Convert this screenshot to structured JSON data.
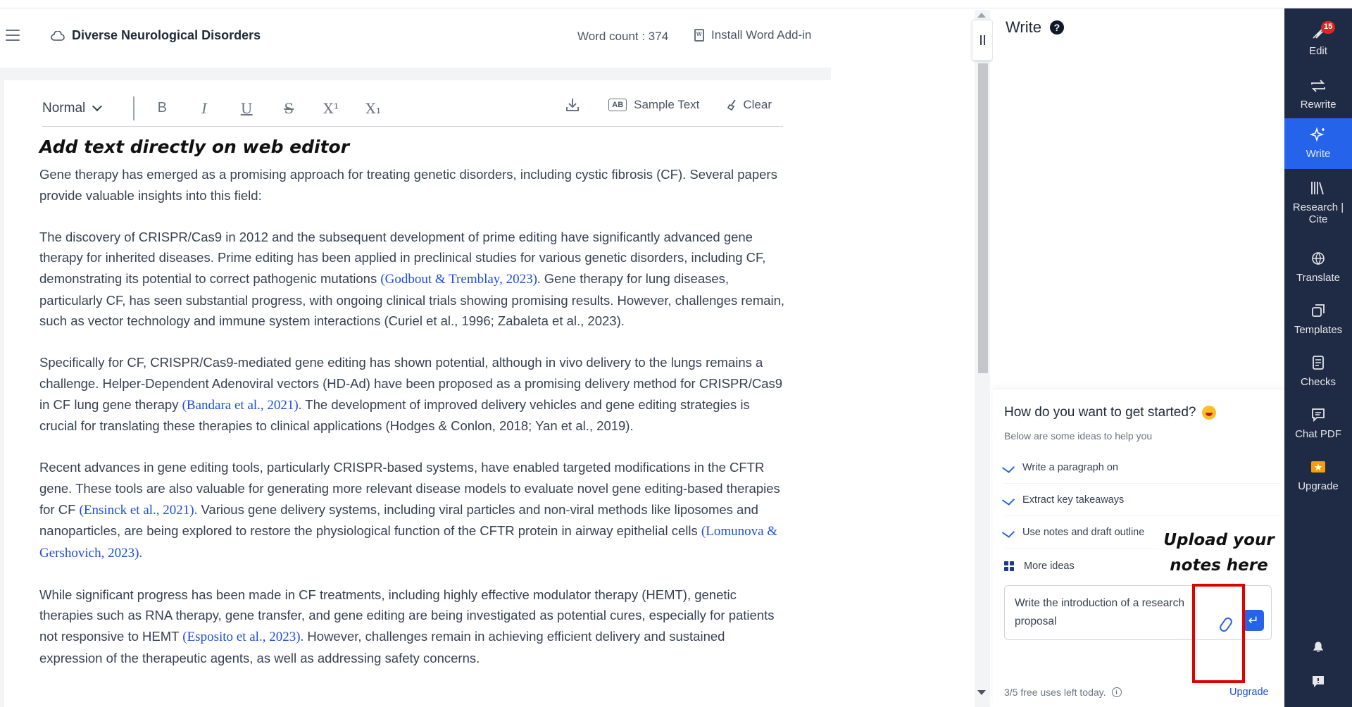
{
  "header": {
    "doc_title": "Diverse Neurological Disorders",
    "word_count": "Word count : 374",
    "install_addin": "Install Word Add-in"
  },
  "toolbar": {
    "style_select": "Normal",
    "bold": "B",
    "italic": "I",
    "underline": "U",
    "strike": "S",
    "superscript": "X¹",
    "subscript": "X₁",
    "sample_badge": "AB",
    "sample_text": "Sample Text",
    "clear": "Clear"
  },
  "content": {
    "heading": "Add text directly on web editor",
    "p1": "Gene therapy has emerged as a promising approach for treating genetic disorders, including cystic fibrosis (CF). Several papers provide valuable insights into this field:",
    "p2a": "The discovery of CRISPR/Cas9 in 2012 and the subsequent development of prime editing have significantly advanced gene therapy for inherited diseases. Prime editing has been applied in preclinical studies for various genetic disorders, including CF, demonstrating its potential to correct pathogenic mutations ",
    "p2_cite": "(Godbout & Tremblay, 2023).",
    "p2b": " Gene therapy for lung diseases, particularly CF, has seen substantial progress, with ongoing clinical trials showing promising results. However, challenges remain, such as vector technology and immune system interactions (Curiel et al., 1996; Zabaleta et al., 2023).",
    "p3a": "Specifically for CF, CRISPR/Cas9-mediated gene editing has shown potential, although in vivo delivery to the lungs remains a challenge. Helper-Dependent Adenoviral vectors (HD-Ad) have been proposed as a promising delivery method for CRISPR/Cas9 in CF lung gene therapy ",
    "p3_cite": "(Bandara et al., 2021).",
    "p3b": " The development of improved delivery vehicles and gene editing strategies is crucial for translating these therapies to clinical applications (Hodges & Conlon, 2018; Yan et al., 2019).",
    "p4a": "Recent advances in gene editing tools, particularly CRISPR-based systems, have enabled targeted modifications in the CFTR gene. These tools are also valuable for generating more relevant disease models to evaluate novel gene editing-based therapies for CF ",
    "p4_cite1": "(Ensinck et al., 2021).",
    "p4b": " Various gene delivery systems, including viral particles and non-viral methods like liposomes and nanoparticles, are being explored to restore the physiological function of the CFTR protein in airway epithelial cells ",
    "p4_cite2": "(Lomunova & Gershovich, 2023).",
    "p5a": "While significant progress has been made in CF treatments, including highly effective modulator therapy (HEMT), genetic therapies such as RNA therapy, gene transfer, and gene editing are being investigated as potential cures, especially for patients not responsive to HEMT ",
    "p5_cite": "(Esposito et al., 2023).",
    "p5b": " However, challenges remain in achieving efficient delivery and sustained expression of the therapeutic agents, as well as addressing safety concerns."
  },
  "write_panel": {
    "title": "Write",
    "help": "?",
    "started_title": "How do you want to get started?",
    "started_sub": "Below are some ideas to help you",
    "ideas": [
      "Write a paragraph on",
      "Extract key takeaways",
      "Use notes and draft outline",
      "More ideas"
    ],
    "annotation_line1": "Upload your",
    "annotation_line2": "notes here",
    "prompt_value": "Write the introduction of a research proposal",
    "send": "↵",
    "uses_left": "3/5 free uses left today.",
    "info": "i",
    "upgrade_link": "Upgrade"
  },
  "rnav": {
    "badge": "15",
    "items": [
      "Edit",
      "Rewrite",
      "Write",
      "Research | Cite",
      "Translate",
      "Templates",
      "Checks",
      "Chat PDF",
      "Upgrade"
    ]
  },
  "colors": {
    "nav_bg": "#1f2a44",
    "accent": "#2563eb",
    "citation": "#1d4ed8",
    "annotation_box": "#e00000"
  }
}
